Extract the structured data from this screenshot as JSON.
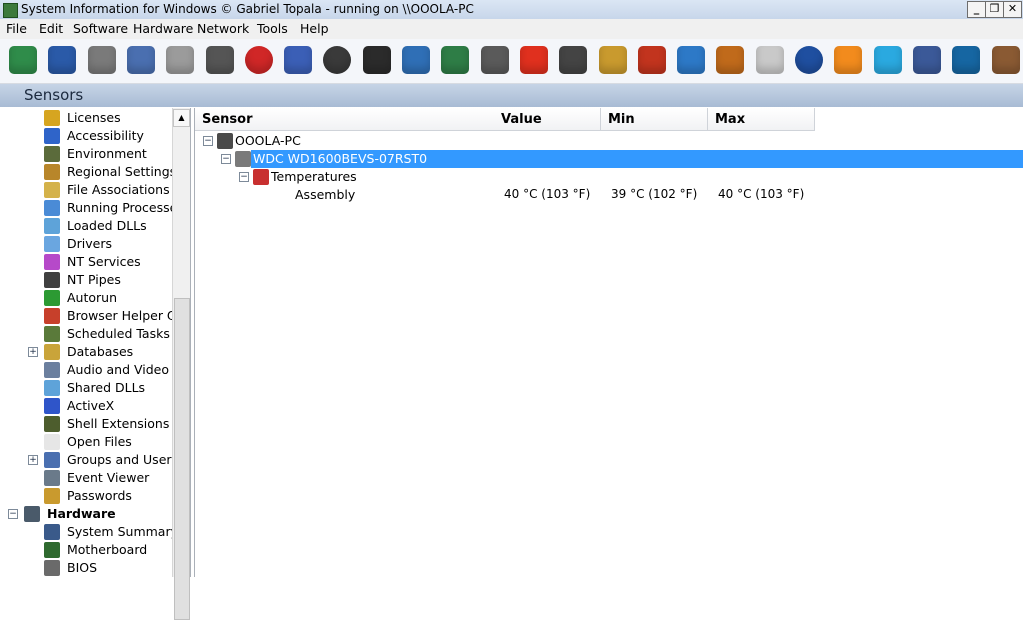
{
  "window": {
    "title": "System Information for Windows  © Gabriel Topala - running on \\\\OOOLA-PC",
    "minimize_glyph": "_",
    "restore_glyph": "❐",
    "close_glyph": "✕"
  },
  "menu": [
    "File",
    "Edit",
    "Software",
    "Hardware",
    "Network",
    "Tools",
    "Help"
  ],
  "toolbar": [
    {
      "icon": "exit-icon",
      "color": "#2f8c4a"
    },
    {
      "icon": "save-icon",
      "color": "#2a5aa8"
    },
    {
      "icon": "cut-icon",
      "color": "#7a7a7a"
    },
    {
      "icon": "copy-icon",
      "color": "#4a6fb0"
    },
    {
      "icon": "paste-icon",
      "color": "#9b9b9b"
    },
    {
      "icon": "print-icon",
      "color": "#555555"
    },
    {
      "icon": "stop-icon",
      "color": "#d02727"
    },
    {
      "icon": "find-icon",
      "color": "#3b5fb6"
    },
    {
      "icon": "gauge-icon",
      "color": "#3a3a3a"
    },
    {
      "icon": "monitor-icon",
      "color": "#2b2b2b"
    },
    {
      "icon": "network-icon",
      "color": "#2f6fb6"
    },
    {
      "icon": "list-icon",
      "color": "#2e7d46"
    },
    {
      "icon": "stopwatch-icon",
      "color": "#5a5a5a"
    },
    {
      "icon": "power-icon",
      "color": "#e0301e"
    },
    {
      "icon": "refresh-icon",
      "color": "#444444"
    },
    {
      "icon": "key-icon",
      "color": "#c99a2e"
    },
    {
      "icon": "tools-icon",
      "color": "#c2341e"
    },
    {
      "icon": "windows-icon",
      "color": "#2d79c7"
    },
    {
      "icon": "home-icon",
      "color": "#c06a1b"
    },
    {
      "icon": "mail-icon",
      "color": "#c9c9c9"
    },
    {
      "icon": "help-icon",
      "color": "#1f4fa0"
    },
    {
      "icon": "rss-icon",
      "color": "#f28b1d"
    },
    {
      "icon": "twitter-icon",
      "color": "#2aa9e0"
    },
    {
      "icon": "facebook-icon",
      "color": "#3b5998"
    },
    {
      "icon": "linkedin-icon",
      "color": "#1666a2"
    },
    {
      "icon": "coffee-icon",
      "color": "#8a5a33"
    }
  ],
  "panel_title": "Sensors",
  "tree": [
    {
      "label": "Licenses",
      "icon": "lock-icon",
      "color": "#d6a520",
      "depth": 1,
      "expander": ""
    },
    {
      "label": "Accessibility",
      "icon": "accessibility-icon",
      "color": "#2f64c9",
      "depth": 1,
      "expander": ""
    },
    {
      "label": "Environment",
      "icon": "environment-icon",
      "color": "#5b6b3b",
      "depth": 1,
      "expander": ""
    },
    {
      "label": "Regional Settings",
      "icon": "globe-icon",
      "color": "#b8862a",
      "depth": 1,
      "expander": ""
    },
    {
      "label": "File Associations",
      "icon": "file-association-icon",
      "color": "#d4b24a",
      "depth": 1,
      "expander": ""
    },
    {
      "label": "Running Processes",
      "icon": "process-icon",
      "color": "#4a8bd6",
      "depth": 1,
      "expander": ""
    },
    {
      "label": "Loaded DLLs",
      "icon": "dll-icon",
      "color": "#5ea3d9",
      "depth": 1,
      "expander": ""
    },
    {
      "label": "Drivers",
      "icon": "driver-icon",
      "color": "#6aa6e0",
      "depth": 1,
      "expander": ""
    },
    {
      "label": "NT Services",
      "icon": "services-icon",
      "color": "#b649c9",
      "depth": 1,
      "expander": ""
    },
    {
      "label": "NT Pipes",
      "icon": "pipe-icon",
      "color": "#404040",
      "depth": 1,
      "expander": ""
    },
    {
      "label": "Autorun",
      "icon": "autorun-icon",
      "color": "#2c9a33",
      "depth": 1,
      "expander": ""
    },
    {
      "label": "Browser Helper Obje",
      "icon": "browser-helper-icon",
      "color": "#c7402b",
      "depth": 1,
      "expander": ""
    },
    {
      "label": "Scheduled Tasks",
      "icon": "task-icon",
      "color": "#5a7a3a",
      "depth": 1,
      "expander": ""
    },
    {
      "label": "Databases",
      "icon": "database-icon",
      "color": "#c9a43a",
      "depth": 1,
      "expander": "+"
    },
    {
      "label": "Audio and Video Co",
      "icon": "audio-video-icon",
      "color": "#6b7f9e",
      "depth": 1,
      "expander": ""
    },
    {
      "label": "Shared DLLs",
      "icon": "shared-dll-icon",
      "color": "#5ea3d9",
      "depth": 1,
      "expander": ""
    },
    {
      "label": "ActiveX",
      "icon": "activex-icon",
      "color": "#2f55c9",
      "depth": 1,
      "expander": ""
    },
    {
      "label": "Shell Extensions",
      "icon": "shell-extension-icon",
      "color": "#4d5d2d",
      "depth": 1,
      "expander": ""
    },
    {
      "label": "Open Files",
      "icon": "open-file-icon",
      "color": "#e6e6e6",
      "depth": 1,
      "expander": ""
    },
    {
      "label": "Groups and Users",
      "icon": "users-icon",
      "color": "#4a6fb0",
      "depth": 1,
      "expander": "+"
    },
    {
      "label": "Event Viewer",
      "icon": "event-viewer-icon",
      "color": "#6a7a8a",
      "depth": 1,
      "expander": ""
    },
    {
      "label": "Passwords",
      "icon": "key-icon",
      "color": "#c99a2e",
      "depth": 1,
      "expander": ""
    },
    {
      "label": "Hardware",
      "icon": "hardware-icon",
      "color": "#4a5a6a",
      "depth": 0,
      "expander": "−",
      "bold": true
    },
    {
      "label": "System Summary",
      "icon": "system-summary-icon",
      "color": "#3a5a8a",
      "depth": 1,
      "expander": ""
    },
    {
      "label": "Motherboard",
      "icon": "motherboard-icon",
      "color": "#2f6a2f",
      "depth": 1,
      "expander": ""
    },
    {
      "label": "BIOS",
      "icon": "bios-icon",
      "color": "#6a6a6a",
      "depth": 1,
      "expander": ""
    }
  ],
  "columns": [
    {
      "label": "Sensor"
    },
    {
      "label": "Value"
    },
    {
      "label": "Min"
    },
    {
      "label": "Max"
    }
  ],
  "sensors": [
    {
      "label": "OOOLA-PC",
      "icon": "computer-icon",
      "level": 0,
      "expander": "−"
    },
    {
      "label": "WDC WD1600BEVS-07RST0",
      "icon": "hard-drive-icon",
      "level": 1,
      "expander": "−",
      "selected": true
    },
    {
      "label": "Temperatures",
      "icon": "thermometer-icon",
      "level": 2,
      "expander": "−"
    },
    {
      "label": "Assembly",
      "icon": "",
      "level": 3,
      "expander": "",
      "value": "40 °C  (103 °F)",
      "min": "39 °C  (102 °F)",
      "max": "40 °C  (103 °F)"
    }
  ]
}
